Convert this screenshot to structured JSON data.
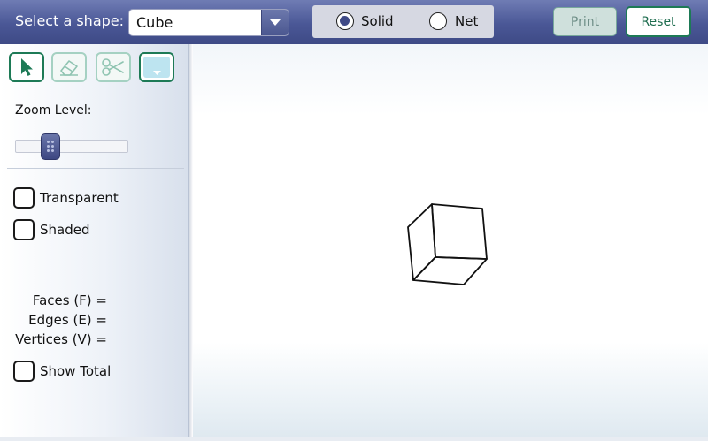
{
  "toolbar": {
    "shape_label": "Select a shape:",
    "shape_value": "Cube",
    "modes": [
      {
        "label": "Solid",
        "checked": true
      },
      {
        "label": "Net",
        "checked": false
      }
    ],
    "print_label": "Print",
    "reset_label": "Reset"
  },
  "tools": [
    {
      "name": "select-tool",
      "icon": "arrow-cursor-icon",
      "active": true
    },
    {
      "name": "erase-tool",
      "icon": "eraser-icon",
      "active": false
    },
    {
      "name": "cut-tool",
      "icon": "scissors-icon",
      "active": false
    },
    {
      "name": "color-tool",
      "icon": "color-swatch-icon",
      "color": "#bde4f0"
    }
  ],
  "sidebar": {
    "zoom_label": "Zoom Level:",
    "zoom_fraction": 0.25,
    "transparent_label": "Transparent",
    "shaded_label": "Shaded",
    "faces_label": "Faces (F) =",
    "edges_label": "Edges (E) =",
    "vertices_label": "Vertices (V) =",
    "show_total_label": "Show Total"
  },
  "colors": {
    "header": "#4a5796",
    "accent_green": "#1d7a56",
    "swatch": "#bde4f0"
  }
}
